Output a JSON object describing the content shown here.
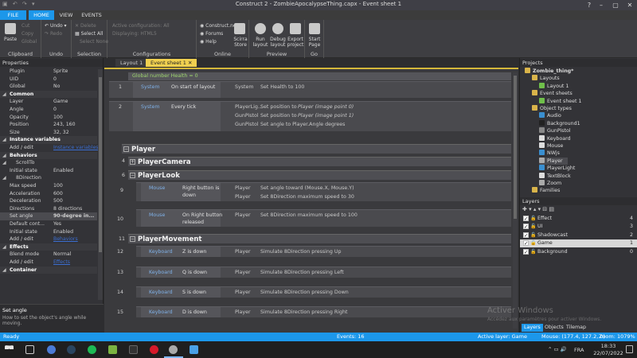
{
  "window": {
    "title": "Construct 2 - ZombieApocalypseThing.capx - Event sheet 1"
  },
  "ribbon": {
    "tabs": [
      "FILE",
      "HOME",
      "VIEW",
      "EVENTS"
    ],
    "clipboard": {
      "paste": "Paste",
      "cut": "Cut",
      "copy": "Copy",
      "global": "Global",
      "label": "Clipboard"
    },
    "undo": {
      "undo": "Undo",
      "redo": "Redo",
      "label": "Undo"
    },
    "selection": {
      "delete": "Delete",
      "select_all": "Select All",
      "select_none": "Select None",
      "label": "Selection"
    },
    "configurations": {
      "active": "Active configuration: All",
      "displaying": "Displaying: HTML5",
      "label": "Configurations"
    },
    "online": {
      "site": "Construct.net",
      "forums": "Forums",
      "help": "Help",
      "store": "Scirra Store",
      "label": "Online"
    },
    "preview": {
      "run": "Run layout",
      "debug": "Debug layout",
      "export": "Export project",
      "label": "Preview"
    },
    "go": {
      "start": "Start Page",
      "label": "Go"
    }
  },
  "properties": {
    "title": "Properties",
    "rows": [
      {
        "k": "Plugin",
        "v": "Sprite"
      },
      {
        "k": "UID",
        "v": "0"
      },
      {
        "k": "Global",
        "v": "No"
      },
      {
        "k": "Common",
        "v": "",
        "sec": true
      },
      {
        "k": "Layer",
        "v": "Game"
      },
      {
        "k": "Angle",
        "v": "0"
      },
      {
        "k": "Opacity",
        "v": "100"
      },
      {
        "k": "Position",
        "v": "243, 160"
      },
      {
        "k": "Size",
        "v": "32, 32"
      },
      {
        "k": "Instance variables",
        "v": "",
        "sec": true
      },
      {
        "k": "Add / edit",
        "v": "Instance variables"
      },
      {
        "k": "Behaviors",
        "v": "",
        "sec": true
      },
      {
        "k": "ScrollTo",
        "v": "",
        "sub": true
      },
      {
        "k": "Initial state",
        "v": "Enabled"
      },
      {
        "k": "8Direction",
        "v": "",
        "sub": true
      },
      {
        "k": "Max speed",
        "v": "100"
      },
      {
        "k": "Acceleration",
        "v": "600"
      },
      {
        "k": "Deceleration",
        "v": "500"
      },
      {
        "k": "Directions",
        "v": "8 directions"
      },
      {
        "k": "Set angle",
        "v": "90-degree in..."
      },
      {
        "k": "Default cont...",
        "v": "Yes"
      },
      {
        "k": "Initial state",
        "v": "Enabled"
      },
      {
        "k": "Add / edit",
        "v": "Behaviors"
      },
      {
        "k": "Effects",
        "v": "",
        "sec": true
      },
      {
        "k": "Blend mode",
        "v": "Normal"
      },
      {
        "k": "Add / edit",
        "v": "Effects"
      },
      {
        "k": "Container",
        "v": "",
        "sec": true
      }
    ],
    "desc_title": "Set angle",
    "desc_text": "How to set the object's angle while moving."
  },
  "doc_tabs": [
    "Layout 1",
    "Event sheet 1"
  ],
  "events": {
    "global": "Global number Health = 0",
    "e1": {
      "n": "1",
      "obj": "System",
      "cond": "On start of layout",
      "a1_obj": "System",
      "a1": "Set Health to 100"
    },
    "e2": {
      "n": "2",
      "obj": "System",
      "cond": "Every tick",
      "a1_obj": "PlayerLig...",
      "a1": "Set position to",
      "a1b": "Player (image point 0)",
      "a2_obj": "GunPistol",
      "a2": "Set position to",
      "a2b": "Player (image point 1)",
      "a3_obj": "GunPistol",
      "a3": "Set angle to Player.Angle degrees"
    },
    "g_player": "Player",
    "g_cam": {
      "n": "4",
      "name": "PlayerCamera"
    },
    "g_look": {
      "n": "6",
      "name": "PlayerLook"
    },
    "e9": {
      "n": "9",
      "obj": "Mouse",
      "c1": "Right button is",
      "c2": "down",
      "a1_obj": "Player",
      "a1": "Set angle toward (Mouse.X, Mouse.Y)",
      "a2_obj": "Player",
      "a2": "Set  8Direction maximum speed to 30"
    },
    "e10": {
      "n": "10",
      "obj": "Mouse",
      "c1": "On Right button",
      "c2": "released",
      "a1_obj": "Player",
      "a1": "Set  8Direction maximum speed to 100"
    },
    "g_move": {
      "n": "11",
      "name": "PlayerMovement"
    },
    "e12": {
      "n": "12",
      "obj": "Keyboard",
      "cond": "Z is down",
      "a_obj": "Player",
      "act": "Simulate  8Direction pressing Up"
    },
    "e13": {
      "n": "13",
      "obj": "Keyboard",
      "cond": "Q is down",
      "a_obj": "Player",
      "act": "Simulate  8Direction pressing Left"
    },
    "e14": {
      "n": "14",
      "obj": "Keyboard",
      "cond": "S is down",
      "a_obj": "Player",
      "act": "Simulate  8Direction pressing Down"
    },
    "e15": {
      "n": "15",
      "obj": "Keyboard",
      "cond": "D is down",
      "a_obj": "Player",
      "act": "Simulate  8Direction pressing Right"
    },
    "nums": {
      "n3": "3",
      "n5": "5",
      "n7": "7",
      "n8": "8"
    }
  },
  "projects": {
    "title": "Projects",
    "items": [
      {
        "t": "Zombie_thing*",
        "d": 0,
        "c": "#d9b44a"
      },
      {
        "t": "Layouts",
        "d": 1,
        "c": "#d9b44a"
      },
      {
        "t": "Layout 1",
        "d": 2,
        "c": "#6fbf4a"
      },
      {
        "t": "Event sheets",
        "d": 1,
        "c": "#d9b44a"
      },
      {
        "t": "Event sheet 1",
        "d": 2,
        "c": "#6fbf4a"
      },
      {
        "t": "Object types",
        "d": 1,
        "c": "#d9b44a"
      },
      {
        "t": "Audio",
        "d": 2,
        "c": "#3a8fd0"
      },
      {
        "t": "Background1",
        "d": 2,
        "c": "#222"
      },
      {
        "t": "GunPistol",
        "d": 2,
        "c": "#888"
      },
      {
        "t": "Keyboard",
        "d": 2,
        "c": "#ddd"
      },
      {
        "t": "Mouse",
        "d": 2,
        "c": "#ddd"
      },
      {
        "t": "NWjs",
        "d": 2,
        "c": "#3a8fd0"
      },
      {
        "t": "Player",
        "d": 2,
        "c": "#aaa"
      },
      {
        "t": "PlayerLight",
        "d": 2,
        "c": "#3a8fd0"
      },
      {
        "t": "TextBlock",
        "d": 2,
        "c": "#ddd"
      },
      {
        "t": "Zoom",
        "d": 2,
        "c": "#aaa"
      },
      {
        "t": "Families",
        "d": 1,
        "c": "#d9b44a"
      }
    ]
  },
  "layers": {
    "title": "Layers",
    "rows": [
      {
        "name": "Effect",
        "n": "4"
      },
      {
        "name": "UI",
        "n": "3"
      },
      {
        "name": "Shadowcast",
        "n": "2"
      },
      {
        "name": "Game",
        "n": "1"
      },
      {
        "name": "Background",
        "n": "0"
      }
    ],
    "tabs": [
      "Layers",
      "Objects",
      "Tilemap"
    ]
  },
  "status": {
    "ready": "Ready",
    "events": "Events: 16",
    "layer": "Active layer: Game",
    "mouse": "Mouse: (177.4, 127.2, 0)",
    "zoom": "Zoom: 1079%"
  },
  "taskbar": {
    "time": "18:33",
    "date": "22/07/2022",
    "lang": "FRA"
  },
  "watermark": {
    "l1": "Activer Windows",
    "l2": "Accédez aux paramètres pour activer Windows."
  }
}
